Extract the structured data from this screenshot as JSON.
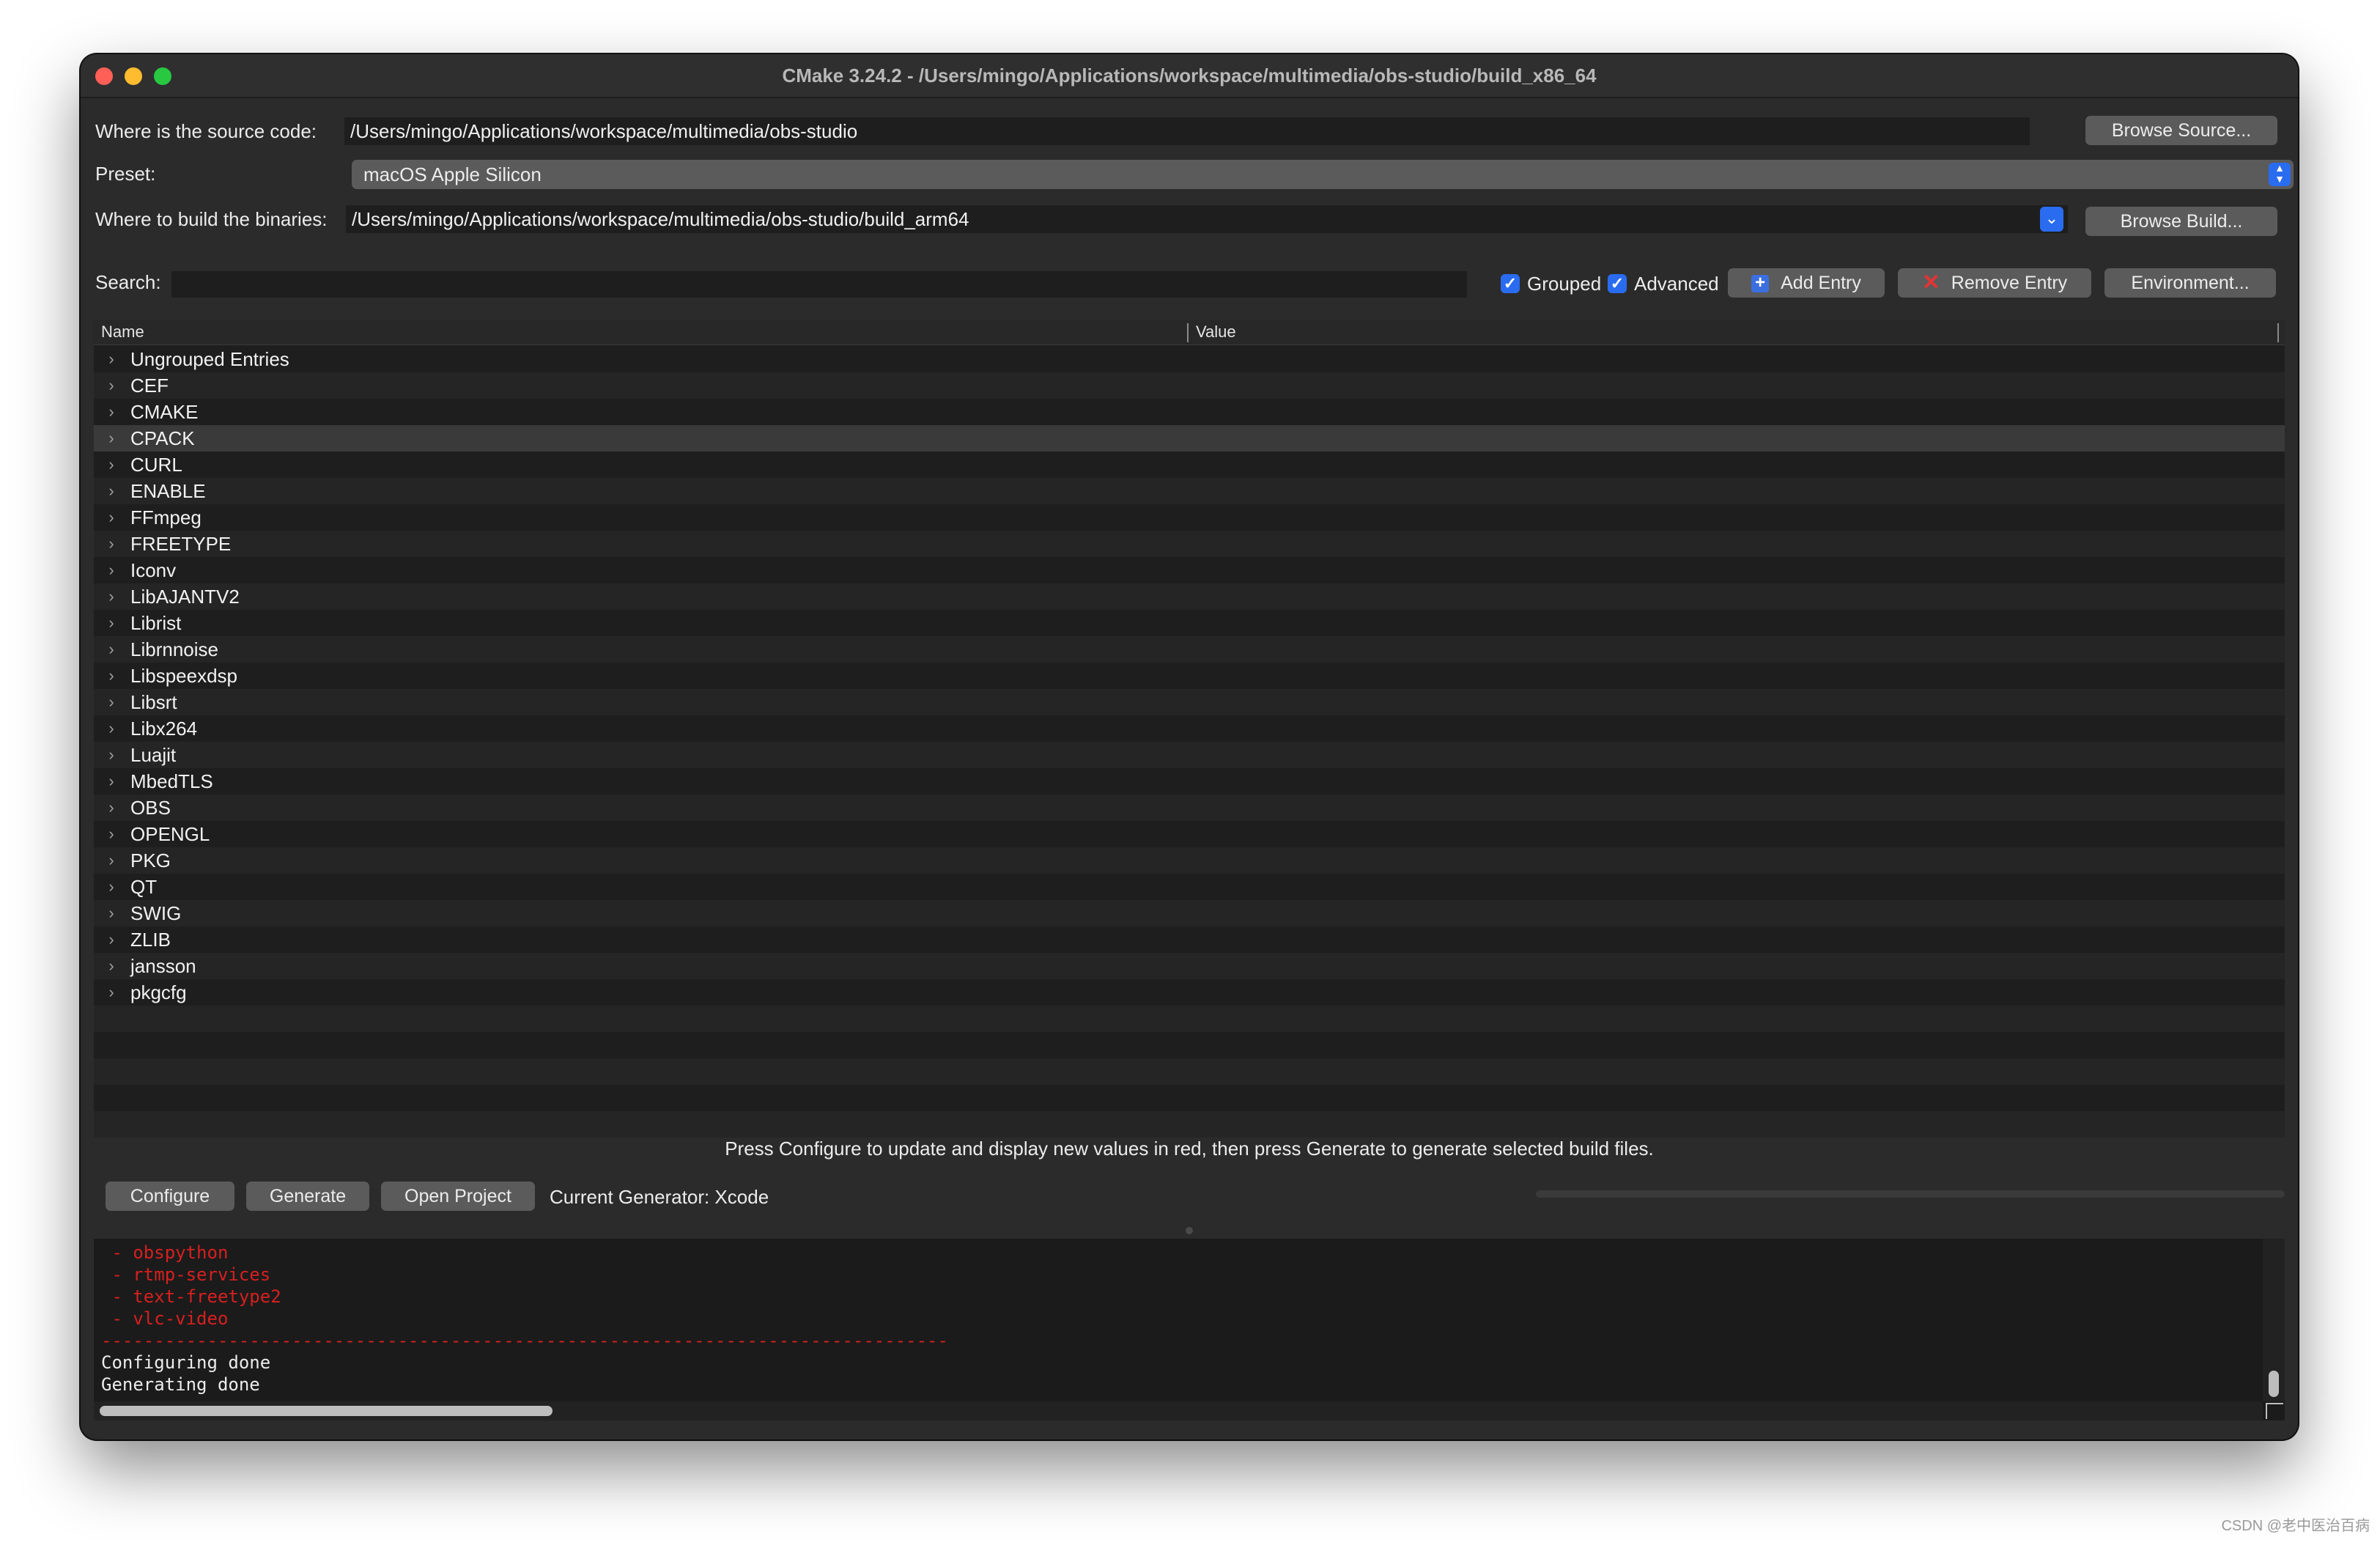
{
  "window": {
    "title": "CMake 3.24.2 - /Users/mingo/Applications/workspace/multimedia/obs-studio/build_x86_64"
  },
  "source": {
    "label": "Where is the source code:",
    "path": "/Users/mingo/Applications/workspace/multimedia/obs-studio",
    "browse_label": "Browse Source..."
  },
  "preset": {
    "label": "Preset:",
    "value": "macOS Apple Silicon"
  },
  "build": {
    "label": "Where to build the binaries:",
    "path": "/Users/mingo/Applications/workspace/multimedia/obs-studio/build_arm64",
    "browse_label": "Browse Build..."
  },
  "search": {
    "label": "Search:",
    "value": ""
  },
  "options": {
    "grouped_label": "Grouped",
    "grouped_checked": true,
    "advanced_label": "Advanced",
    "advanced_checked": true,
    "add_entry_label": "Add Entry",
    "remove_entry_label": "Remove Entry",
    "environment_label": "Environment..."
  },
  "table": {
    "columns": [
      "Name",
      "Value"
    ],
    "selected": "CPACK",
    "groups": [
      "Ungrouped Entries",
      "CEF",
      "CMAKE",
      "CPACK",
      "CURL",
      "ENABLE",
      "FFmpeg",
      "FREETYPE",
      "Iconv",
      "LibAJANTV2",
      "Librist",
      "Librnnoise",
      "Libspeexdsp",
      "Libsrt",
      "Libx264",
      "Luajit",
      "MbedTLS",
      "OBS",
      "OPENGL",
      "PKG",
      "QT",
      "SWIG",
      "ZLIB",
      "jansson",
      "pkgcfg"
    ],
    "empty_rows": 5
  },
  "help_text": "Press Configure to update and display new values in red, then press Generate to generate selected build files.",
  "actions": {
    "configure_label": "Configure",
    "generate_label": "Generate",
    "open_project_label": "Open Project",
    "generator_text": "Current Generator: Xcode"
  },
  "console": {
    "lines": [
      {
        "text": " - obspython",
        "color": "red"
      },
      {
        "text": " - rtmp-services",
        "color": "red"
      },
      {
        "text": " - text-freetype2",
        "color": "red"
      },
      {
        "text": " - vlc-video",
        "color": "red"
      },
      {
        "text": "--------------------------------------------------------------------------------",
        "color": "red"
      },
      {
        "text": "Configuring done",
        "color": "white"
      },
      {
        "text": "Generating done",
        "color": "white"
      }
    ]
  },
  "watermark": "CSDN @老中医治百病",
  "colors": {
    "window_bg": "#2b2b2b",
    "accent": "#2a6cf0",
    "console_error": "#d62020"
  }
}
